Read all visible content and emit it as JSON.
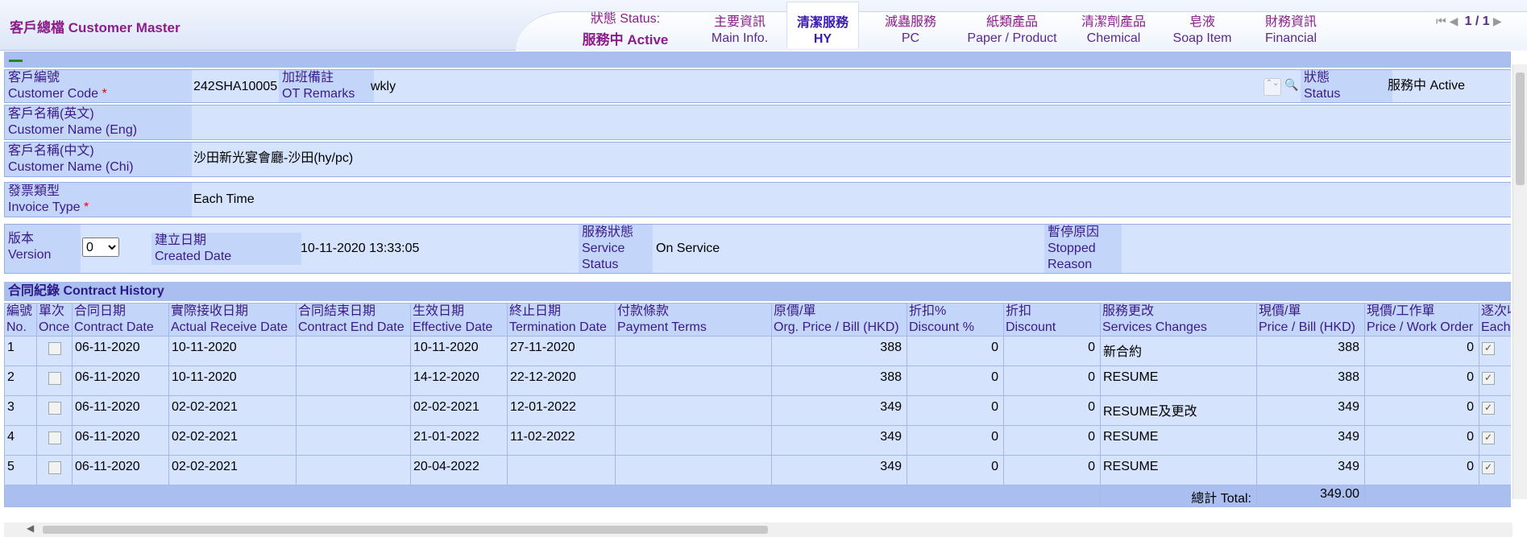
{
  "app": {
    "title": "客戶總檔 Customer Master"
  },
  "status": {
    "label": "狀態 Status:",
    "value": "服務中 Active"
  },
  "tabs": [
    {
      "zh": "主要資訊",
      "en": "Main Info."
    },
    {
      "zh": "清潔服務",
      "en": "HY"
    },
    {
      "zh": "滅蟲服務",
      "en": "PC"
    },
    {
      "zh": "紙類產品",
      "en": "Paper / Product"
    },
    {
      "zh": "清潔劑產品",
      "en": "Chemical"
    },
    {
      "zh": "皂液",
      "en": "Soap Item"
    },
    {
      "zh": "財務資訊",
      "en": "Financial"
    }
  ],
  "active_tab": "HY",
  "pager": {
    "count": "1 / 1"
  },
  "form": {
    "customer_code_zh": "客戶編號",
    "customer_code_en": "Customer Code",
    "customer_code_value": "242SHA10005",
    "ot_zh": "加班備註",
    "ot_en": "OT Remarks",
    "ot_value": "wkly",
    "status_zh": "狀態",
    "status_en": "Status",
    "status_value": "服務中 Active",
    "name_eng_zh": "客戶名稱(英文)",
    "name_eng_en": "Customer Name (Eng)",
    "name_eng_value": "",
    "name_chi_zh": "客戶名稱(中文)",
    "name_chi_en": "Customer Name (Chi)",
    "name_chi_value": "沙田新光宴會廳-沙田(hy/pc)",
    "invoice_zh": "發票類型",
    "invoice_en": "Invoice Type",
    "invoice_value": "Each Time",
    "version_zh": "版本",
    "version_en": "Version",
    "version_value": "0",
    "created_zh": "建立日期",
    "created_en": "Created Date",
    "created_value": "10-11-2020 13:33:05",
    "svc_zh": "服務狀態",
    "svc_en1": "Service",
    "svc_en2": "Status",
    "svc_value": "On Service",
    "stop_zh": "暫停原因",
    "stop_en1": "Stopped",
    "stop_en2": "Reason",
    "stop_value": ""
  },
  "contract": {
    "title": "合同紀錄 Contract History",
    "headers": [
      {
        "zh": "編號",
        "en": "No."
      },
      {
        "zh": "單次",
        "en": "Once"
      },
      {
        "zh": "合同日期",
        "en": "Contract Date"
      },
      {
        "zh": "實際接收日期",
        "en": "Actual Receive Date"
      },
      {
        "zh": "合同結束日期",
        "en": "Contract End Date"
      },
      {
        "zh": "生效日期",
        "en": "Effective Date"
      },
      {
        "zh": "終止日期",
        "en": "Termination Date"
      },
      {
        "zh": "付款條款",
        "en": "Payment Terms"
      },
      {
        "zh": "原價/單",
        "en": "Org. Price / Bill (HKD)"
      },
      {
        "zh": "折扣%",
        "en": "Discount %"
      },
      {
        "zh": "折扣",
        "en": "Discount"
      },
      {
        "zh": "服務更改",
        "en": "Services Changes"
      },
      {
        "zh": "現價/單",
        "en": "Price / Bill (HKD)"
      },
      {
        "zh": "現價/工作單",
        "en": "Price / Work Order"
      },
      {
        "zh": "逐次收",
        "en": "Each T"
      }
    ],
    "rows": [
      {
        "no": "1",
        "once": false,
        "contract_date": "06-11-2020",
        "receive_date": "10-11-2020",
        "end_date": "",
        "effective": "10-11-2020",
        "termination": "27-11-2020",
        "payment": "",
        "org_price": "388",
        "disc_pct": "0",
        "discount": "0",
        "changes": "新合約",
        "price_bill": "388",
        "price_wo": "0",
        "each": true
      },
      {
        "no": "2",
        "once": false,
        "contract_date": "06-11-2020",
        "receive_date": "10-11-2020",
        "end_date": "",
        "effective": "14-12-2020",
        "termination": "22-12-2020",
        "payment": "",
        "org_price": "388",
        "disc_pct": "0",
        "discount": "0",
        "changes": "RESUME",
        "price_bill": "388",
        "price_wo": "0",
        "each": true
      },
      {
        "no": "3",
        "once": false,
        "contract_date": "06-11-2020",
        "receive_date": "02-02-2021",
        "end_date": "",
        "effective": "02-02-2021",
        "termination": "12-01-2022",
        "payment": "",
        "org_price": "349",
        "disc_pct": "0",
        "discount": "0",
        "changes": "RESUME及更改",
        "price_bill": "349",
        "price_wo": "0",
        "each": true
      },
      {
        "no": "4",
        "once": false,
        "contract_date": "06-11-2020",
        "receive_date": "02-02-2021",
        "end_date": "",
        "effective": "21-01-2022",
        "termination": "11-02-2022",
        "payment": "",
        "org_price": "349",
        "disc_pct": "0",
        "discount": "0",
        "changes": "RESUME",
        "price_bill": "349",
        "price_wo": "0",
        "each": true
      },
      {
        "no": "5",
        "once": false,
        "contract_date": "06-11-2020",
        "receive_date": "02-02-2021",
        "end_date": "",
        "effective": "20-04-2022",
        "termination": "",
        "payment": "",
        "org_price": "349",
        "disc_pct": "0",
        "discount": "0",
        "changes": "RESUME",
        "price_bill": "349",
        "price_wo": "0",
        "each": true
      }
    ],
    "total_label": "總計 Total:",
    "total_value": "349.00"
  },
  "colors": {
    "accent": "#8b1d8b",
    "label_bg": "#c3d5f8",
    "field_bg": "#d5e3fc",
    "bar": "#aabef0"
  },
  "icons": [
    "first-page-icon",
    "prev-page-icon",
    "next-page-icon",
    "last-page-icon",
    "lookup-icon",
    "checkbox-icon"
  ]
}
